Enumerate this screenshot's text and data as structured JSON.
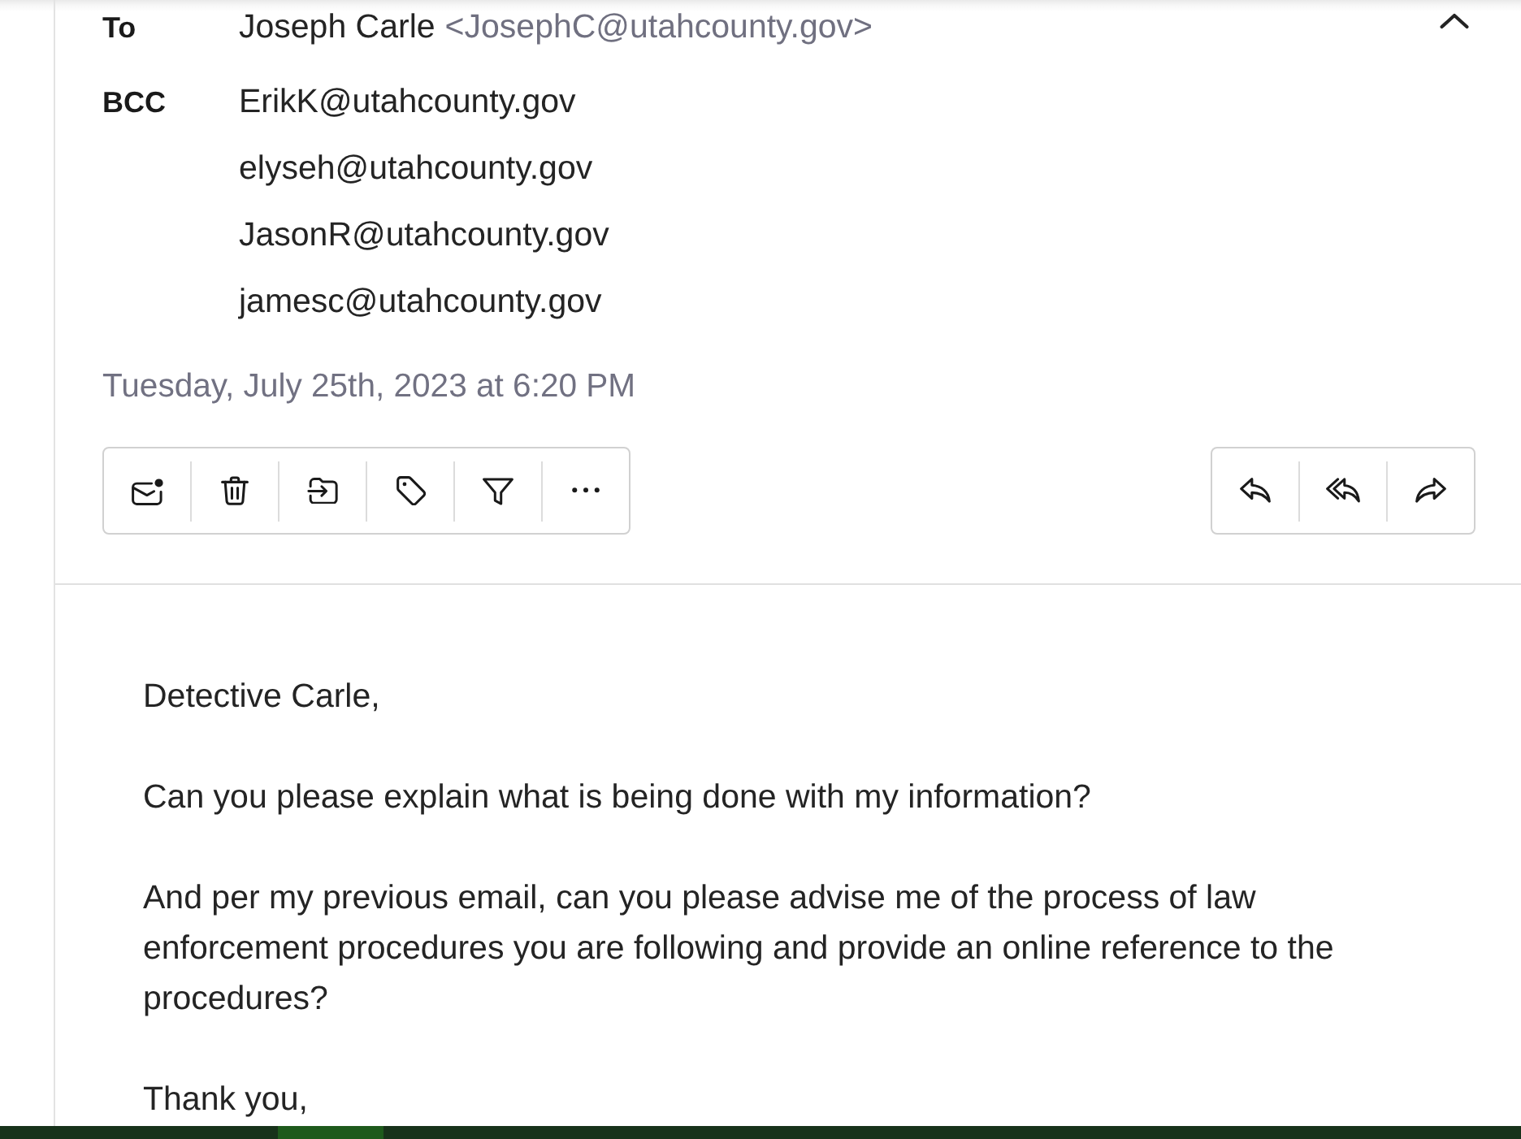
{
  "message_header": {
    "recipients": [
      {
        "label": "To",
        "entries": [
          {
            "name": "Joseph Carle",
            "address": "<JosephC@utahcounty.gov>"
          }
        ]
      },
      {
        "label": "BCC",
        "entries": [
          {
            "address": "ErikK@utahcounty.gov"
          },
          {
            "address": "elyseh@utahcounty.gov"
          },
          {
            "address": "JasonR@utahcounty.gov"
          },
          {
            "address": "jamesc@utahcounty.gov"
          }
        ]
      }
    ],
    "date": "Tuesday, July 25th, 2023 at 6:20 PM"
  },
  "body": {
    "paragraphs": [
      "Detective Carle,",
      "Can you please explain what is being done with my information?",
      "And per my previous email, can you please advise me of the process of law enforcement procedures you are following and provide an online reference to the procedures?",
      "Thank you,"
    ]
  }
}
